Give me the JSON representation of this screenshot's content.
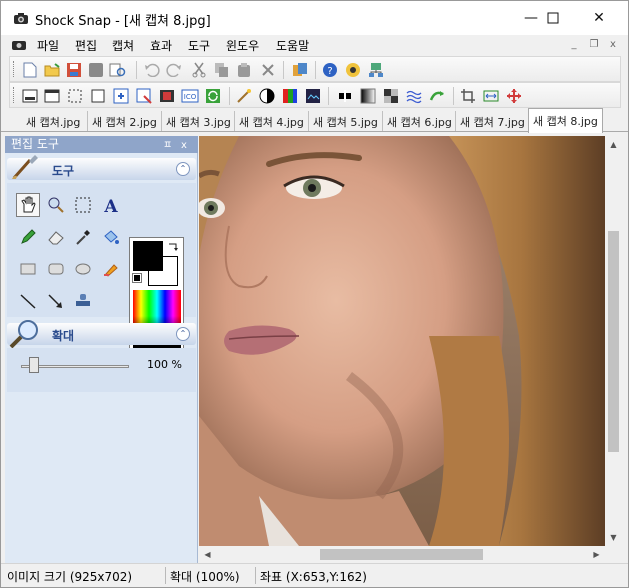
{
  "window": {
    "title": "Shock Snap - [새 캡쳐 8.jpg]",
    "controls": [
      "minimize",
      "maximize",
      "close"
    ]
  },
  "menu": {
    "items": [
      "파일",
      "편집",
      "캡쳐",
      "효과",
      "도구",
      "윈도우",
      "도움말"
    ]
  },
  "toolbar1": {
    "icons": [
      "new-file-icon",
      "open-folder-icon",
      "save-icon",
      "save-disabled-icon",
      "print-preview-icon",
      "undo-icon",
      "redo-icon",
      "cut-icon",
      "copy-icon",
      "paste-icon",
      "delete-icon",
      "gallery-icon",
      "help-icon",
      "capture-eye-icon",
      "network-icon"
    ]
  },
  "toolbar2": {
    "icons": [
      "capture-screen-icon",
      "capture-window-icon",
      "capture-region-icon",
      "capture-rect-icon",
      "capture-scroll-icon",
      "capture-object-icon",
      "capture-movie-icon",
      "capture-icon-icon",
      "refresh-icon",
      "magic-wand-icon",
      "contrast-icon",
      "rgb-icon",
      "image-effect-icon",
      "sharpen-icon",
      "grayscale-icon",
      "pattern-icon",
      "wave-icon",
      "rotate-icon",
      "crop-icon",
      "resize-icon",
      "move-icon"
    ]
  },
  "tabs": [
    {
      "label": "새 캡쳐.jpg",
      "active": false
    },
    {
      "label": "새 캡쳐 2.jpg",
      "active": false
    },
    {
      "label": "새 캡쳐 3.jpg",
      "active": false
    },
    {
      "label": "새 캡쳐 4.jpg",
      "active": false
    },
    {
      "label": "새 캡쳐 5.jpg",
      "active": false
    },
    {
      "label": "새 캡쳐 6.jpg",
      "active": false
    },
    {
      "label": "새 캡쳐 7.jpg",
      "active": false
    },
    {
      "label": "새 캡쳐 8.jpg",
      "active": true
    }
  ],
  "panel": {
    "title": "편집 도구",
    "pin": "ㅍ",
    "close": "x",
    "tools_section": "도구",
    "zoom_section": "확대",
    "zoom_value": "100 %",
    "zoom_level_percent": 100
  },
  "colors": {
    "foreground": "#000000",
    "background": "#ffffff",
    "panel_bg": "#dfe9f5",
    "panel_title": "#8fa5c9"
  },
  "status": {
    "image_size": "이미지 크기 (925x702)",
    "zoom": "확대 (100%)",
    "coords": "좌표 (X:653,Y:162)"
  }
}
